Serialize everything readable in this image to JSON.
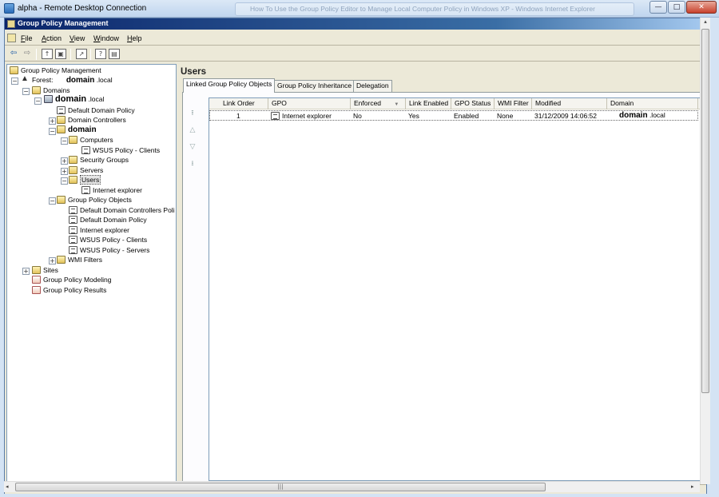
{
  "rdp_window": {
    "title": "alpha - Remote Desktop Connection",
    "background_tab_text": "How To Use the Group Policy Editor to Manage Local Computer Policy in Windows XP - Windows Internet Explorer",
    "minimize": "—",
    "maximize": "□",
    "close": "✕"
  },
  "app": {
    "title": "Group Policy Management",
    "menu": [
      "File",
      "Action",
      "View",
      "Window",
      "Help"
    ],
    "toolbar": {
      "back": "⇦",
      "forward": "⇨",
      "up": "↑",
      "show_hide": "▣",
      "export": "↗",
      "help": "?",
      "properties": "▤"
    }
  },
  "tree": {
    "root": "Group Policy Management",
    "forest_label": "Forest:",
    "forest_name": "domain",
    "forest_suffix": ".local",
    "domains": "Domains",
    "domain_name": "domain",
    "domain_suffix": ".local",
    "default_domain_policy": "Default Domain Policy",
    "domain_controllers": "Domain Controllers",
    "ou_domain": "domain",
    "computers": "Computers",
    "wsus_clients_link": "WSUS Policy - Clients",
    "security_groups": "Security Groups",
    "servers": "Servers",
    "users": "Users",
    "ie_link": "Internet explorer",
    "gpo_container": "Group Policy Objects",
    "gpos": [
      "Default Domain Controllers Poli",
      "Default Domain Policy",
      "Internet explorer",
      "WSUS Policy - Clients",
      "WSUS Policy - Servers"
    ],
    "wmi_filters": "WMI Filters",
    "sites": "Sites",
    "modeling": "Group Policy Modeling",
    "results": "Group Policy Results"
  },
  "right_pane": {
    "title": "Users",
    "tabs": [
      "Linked Group Policy Objects",
      "Group Policy Inheritance",
      "Delegation"
    ],
    "order_buttons": {
      "top": "⭱",
      "up": "△",
      "down": "▽",
      "bottom": "⭳"
    },
    "columns": [
      "Link Order",
      "GPO",
      "Enforced",
      "Link Enabled",
      "GPO Status",
      "WMI Filter",
      "Modified",
      "Domain"
    ],
    "sort_indicator": "▼",
    "rows": [
      {
        "link_order": "1",
        "gpo": "Internet explorer",
        "enforced": "No",
        "link_enabled": "Yes",
        "gpo_status": "Enabled",
        "wmi_filter": "None",
        "modified": "31/12/2009 14:06:52",
        "domain_name": "domain",
        "domain_suffix": ".local"
      }
    ]
  },
  "scrollbars": {
    "grip": "|||",
    "left": "◂",
    "right": "▸",
    "up": "▴"
  }
}
